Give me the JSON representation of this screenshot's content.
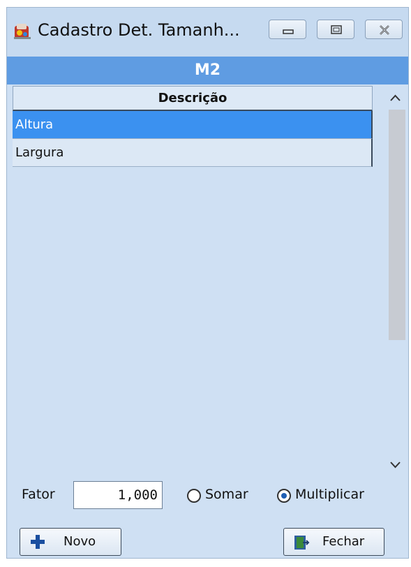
{
  "window": {
    "title": "Cadastro Det. Tamanh...",
    "controls": [
      "minimize-icon",
      "maximize-icon",
      "close-icon"
    ]
  },
  "header": {
    "title": "M2"
  },
  "grid": {
    "column_header": "Descrição",
    "rows": [
      {
        "label": "Altura",
        "selected": true
      },
      {
        "label": "Largura",
        "selected": false
      }
    ]
  },
  "form": {
    "fator_label": "Fator",
    "fator_value": "1,000",
    "operation_options": [
      {
        "label": "Somar",
        "selected": false
      },
      {
        "label": "Multiplicar",
        "selected": true
      }
    ]
  },
  "buttons": {
    "novo": "Novo",
    "fechar": "Fechar"
  },
  "colors": {
    "header_band": "#5f9ce2",
    "selected_row": "#3b91f0",
    "window_bg": "#cfe0f3"
  }
}
